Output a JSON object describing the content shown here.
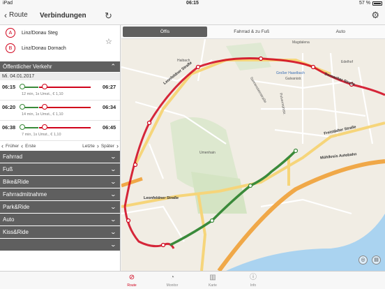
{
  "status": {
    "device": "iPad",
    "time": "06:15",
    "battery": "57 %"
  },
  "nav": {
    "back_label": "Route",
    "title": "Verbindungen"
  },
  "route": {
    "from_letter": "A",
    "from": "Linz/Donau Steg",
    "to_letter": "B",
    "to": "Linz/Donau Dornach"
  },
  "oev": {
    "title": "Öffentlicher Verkehr",
    "date": "Mi. 04.01.2017"
  },
  "connections": [
    {
      "dep": "06:15",
      "arr": "06:27",
      "info": "12 min, 1x Umst., € 1,10"
    },
    {
      "dep": "06:20",
      "arr": "06:34",
      "info": "14 min, 1x Umst., € 1,10"
    },
    {
      "dep": "06:38",
      "arr": "06:45",
      "info": "7 min, 1x Umst., € 1,10"
    }
  ],
  "pager": {
    "earlier": "Früher",
    "first": "Erste",
    "last": "Letzte",
    "later": "Später"
  },
  "categories": [
    "Fahrrad",
    "Fuß",
    "Bike&Ride",
    "Fahrradmitnahme",
    "Park&Ride",
    "Auto",
    "Kiss&Ride",
    ""
  ],
  "tabs": [
    "Öffis",
    "Fahrrad & zu Fuß",
    "Auto"
  ],
  "map_labels": {
    "magdalena": "Magdalena",
    "haibach": "Haibach",
    "leonfeldner": "Leonfeldner Straße",
    "leonfeldner2": "Leonfeldner Straße",
    "freistaedter": "Freistädter Straße",
    "muehlkreis": "Mühlkreis Autobahn",
    "umenhain": "Umenhain",
    "dornacher": "Dornacher Straße",
    "pulvermuehl": "Pulvermühlstr.",
    "grossertruebe": "Großer Haselbach",
    "edelhof": "Edelhof",
    "sonnensteinstr": "Sonnensteinstraße",
    "galvanistr": "Galvanistr."
  },
  "tabbar": [
    {
      "icon": "compass-icon",
      "label": "Route"
    },
    {
      "icon": "monitor-icon",
      "label": "Monitor"
    },
    {
      "icon": "map-icon",
      "label": "Karte"
    },
    {
      "icon": "info-icon",
      "label": "Info"
    }
  ],
  "colors": {
    "accent": "#d0021b",
    "walk": "#3a8a3a",
    "header": "#5f5f5f"
  }
}
